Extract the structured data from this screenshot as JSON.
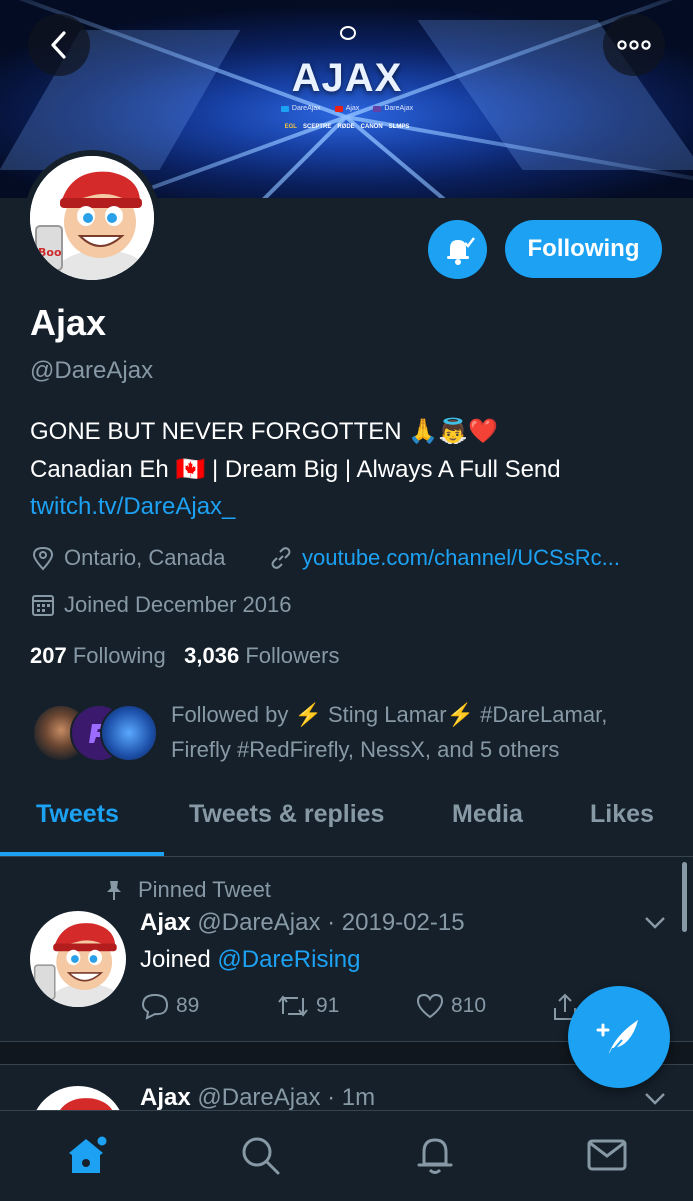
{
  "header": {
    "back_icon": "chevron-left-icon",
    "more_icon": "more-horizontal-icon"
  },
  "banner": {
    "title": "AJAX",
    "socials": [
      "DareAjax",
      "Ajax",
      "DareAjax"
    ],
    "sponsors": [
      "EGL",
      "SCEPTRE",
      "RØDE",
      "CANON",
      "SLMPS"
    ]
  },
  "profile": {
    "name": "Ajax",
    "handle": "@DareAjax",
    "bio_line1": "GONE BUT NEVER FORGOTTEN 🙏👼❤️",
    "bio_line2": "Canadian Eh 🇨🇦 | Dream Big | Always A Full Send",
    "bio_link": "twitch.tv/DareAjax_",
    "location": "Ontario, Canada",
    "website": "youtube.com/channel/UCSsRc...",
    "joined": "Joined December 2016",
    "following_count": "207",
    "following_label": "Following",
    "followers_count": "3,036",
    "followers_label": "Followers",
    "followed_by": "Followed by ⚡ Sting Lamar⚡ #DareLamar, Firefly #RedFirefly, NessX, and 5 others"
  },
  "actions": {
    "following_button": "Following",
    "bell_icon": "bell-check-icon"
  },
  "tabs": [
    "Tweets",
    "Tweets & replies",
    "Media",
    "Likes"
  ],
  "active_tab": "Tweets",
  "tweets": [
    {
      "pinned_label": "Pinned Tweet",
      "name": "Ajax",
      "handle": "@DareAjax",
      "time": "· 2019-02-15",
      "text_prefix": "Joined ",
      "text_mention": "@DareRising",
      "replies": "89",
      "retweets": "91",
      "likes": "810"
    },
    {
      "name": "Ajax",
      "handle": "@DareAjax",
      "time": "· 1m"
    }
  ],
  "bottom_nav": [
    "home-icon",
    "search-icon",
    "notifications-icon",
    "messages-icon"
  ],
  "colors": {
    "background": "#15202b",
    "accent": "#1da1f2",
    "secondary_text": "#8899a6",
    "border": "#38444d"
  }
}
